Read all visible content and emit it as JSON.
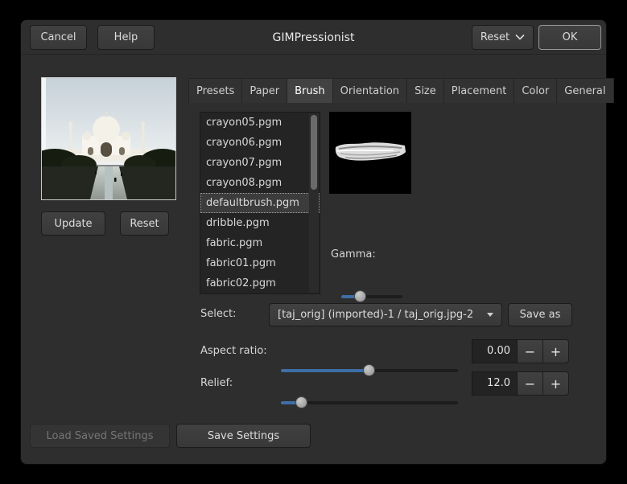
{
  "window": {
    "title": "GIMPressionist"
  },
  "header": {
    "cancel_label": "Cancel",
    "help_label": "Help",
    "reset_label": "Reset",
    "ok_label": "OK"
  },
  "preview": {
    "update_label": "Update",
    "reset_label": "Reset"
  },
  "tabs": [
    "Presets",
    "Paper",
    "Brush",
    "Orientation",
    "Size",
    "Placement",
    "Color",
    "General"
  ],
  "active_tab": "Brush",
  "brush": {
    "files": [
      "crayon05.pgm",
      "crayon06.pgm",
      "crayon07.pgm",
      "crayon08.pgm",
      "defaultbrush.pgm",
      "dribble.pgm",
      "fabric.pgm",
      "fabric01.pgm",
      "fabric02.pgm"
    ],
    "selected_file": "defaultbrush.pgm",
    "gamma_label": "Gamma:",
    "select_label": "Select:",
    "select_value": "[taj_orig] (imported)-1 / taj_orig.jpg-2",
    "save_as_label": "Save as",
    "aspect_ratio_label": "Aspect ratio:",
    "aspect_ratio_value": "0.00",
    "relief_label": "Relief:",
    "relief_value": "12.0",
    "minus_label": "−",
    "plus_label": "+"
  },
  "footer": {
    "load_label": "Load Saved Settings",
    "save_label": "Save Settings"
  },
  "colors": {
    "accent": "#3f6ea6",
    "dialog_bg": "#2e2e2e"
  }
}
